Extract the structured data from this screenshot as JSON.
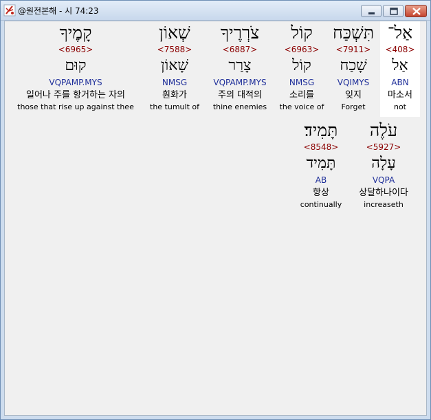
{
  "window": {
    "title": "@원전본해 - 시 74:23",
    "controls": [
      "minimize",
      "maximize",
      "close"
    ]
  },
  "colors": {
    "strong": "#8b0000",
    "morph": "#1f2f9a",
    "selected_background": "#ffffff"
  },
  "words": [
    {
      "hebrew": "אַל־",
      "strong": "<408>",
      "lemma": "אַל",
      "morph": "ABN",
      "korean": "마소서",
      "english": "not",
      "selected": true
    },
    {
      "hebrew": "תִּשְׁכַּח",
      "strong": "<7911>",
      "lemma": "שָׁכַח",
      "morph": "VQIMYS",
      "korean": "잊지",
      "english": "Forget",
      "selected": false
    },
    {
      "hebrew": "קוֹל",
      "strong": "<6963>",
      "lemma": "קוֹל",
      "morph": "NMSG",
      "korean": "소리를",
      "english": "the voice of",
      "selected": false
    },
    {
      "hebrew": "צֹרְרֶיךָ",
      "strong": "<6887>",
      "lemma": "צָרַר",
      "morph": "VQPAMP.MYS",
      "korean": "주의 대적의",
      "english": "thine enemies",
      "selected": false
    },
    {
      "hebrew": "שְׁאוֹן",
      "strong": "<7588>",
      "lemma": "שָׁאוֹן",
      "morph": "NMSG",
      "korean": "훤화가",
      "english": "the tumult of",
      "selected": false
    },
    {
      "hebrew": "קָמֶיךָ",
      "strong": "<6965>",
      "lemma": "קוּם",
      "morph": "VQPAMP.MYS",
      "korean": "일어나 주를 항거하는 자의",
      "english": "those that rise up against thee",
      "selected": false
    },
    {
      "hebrew": "עֹלֶה",
      "strong": "<5927>",
      "lemma": "עָלָה",
      "morph": "VQPA",
      "korean": "상달하나이다",
      "english": "increaseth",
      "selected": false
    },
    {
      "hebrew": "תָּמִיד׃",
      "strong": "<8548>",
      "lemma": "תָּמִיד",
      "morph": "AB",
      "korean": "항상",
      "english": "continually",
      "selected": false
    }
  ]
}
